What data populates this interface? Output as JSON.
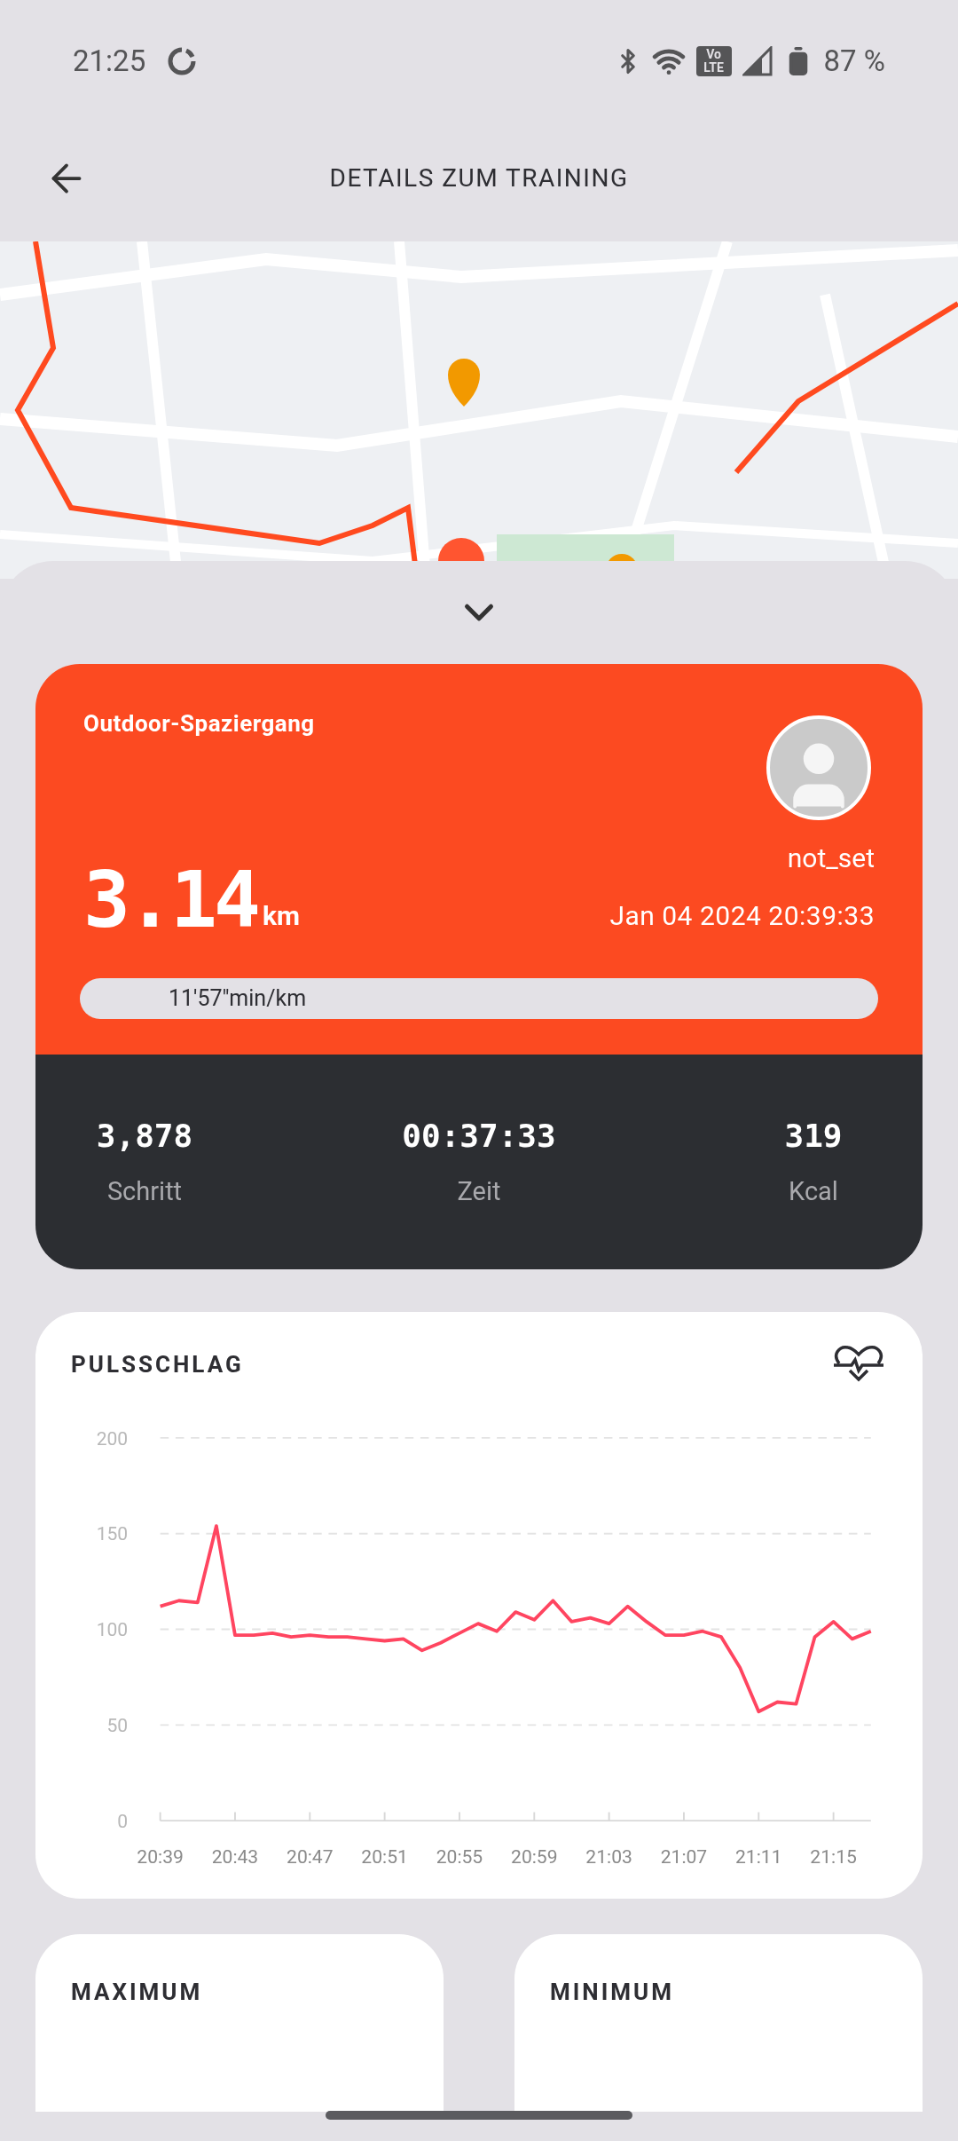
{
  "status_bar": {
    "time": "21:25",
    "volte_badge": [
      "Vo",
      "LTE"
    ],
    "battery": "87 %"
  },
  "toolbar": {
    "title": "DETAILS ZUM TRAINING"
  },
  "summary": {
    "activity": "Outdoor-Spaziergang",
    "distance": "3.14",
    "distance_unit": "km",
    "user": "not_set",
    "datetime": "Jan 04 2024 20:39:33",
    "pace": "11'57\"min/km",
    "stats": [
      {
        "value": "3,878",
        "label": "Schritt"
      },
      {
        "value": "00:37:33",
        "label": "Zeit"
      },
      {
        "value": "319",
        "label": "Kcal"
      }
    ]
  },
  "heart_rate": {
    "title": "PULSSCHLAG",
    "chart_data": {
      "type": "line",
      "categories": [
        "20:39",
        null,
        null,
        null,
        "20:43",
        null,
        null,
        null,
        "20:47",
        null,
        null,
        null,
        "20:51",
        null,
        null,
        null,
        "20:55",
        null,
        null,
        null,
        "20:59",
        null,
        null,
        null,
        "21:03",
        null,
        null,
        null,
        "21:07",
        null,
        null,
        null,
        "21:11",
        null,
        null,
        null,
        "21:15",
        null,
        null
      ],
      "series": [
        {
          "color": "#ff4560",
          "values": [
            112,
            115,
            114,
            154,
            97,
            97,
            98,
            96,
            97,
            96,
            96,
            95,
            94,
            95,
            89,
            93,
            98,
            103,
            99,
            109,
            105,
            115,
            104,
            106,
            103,
            112,
            104,
            97,
            97,
            99,
            96,
            80,
            57,
            62,
            61,
            96,
            104,
            95,
            99
          ]
        }
      ],
      "ylim": [
        0,
        200
      ],
      "yticks": [
        0,
        50,
        100,
        150,
        200
      ],
      "grid": "y"
    }
  },
  "extremes": [
    {
      "title": "MAXIMUM"
    },
    {
      "title": "MINIMUM"
    }
  ]
}
